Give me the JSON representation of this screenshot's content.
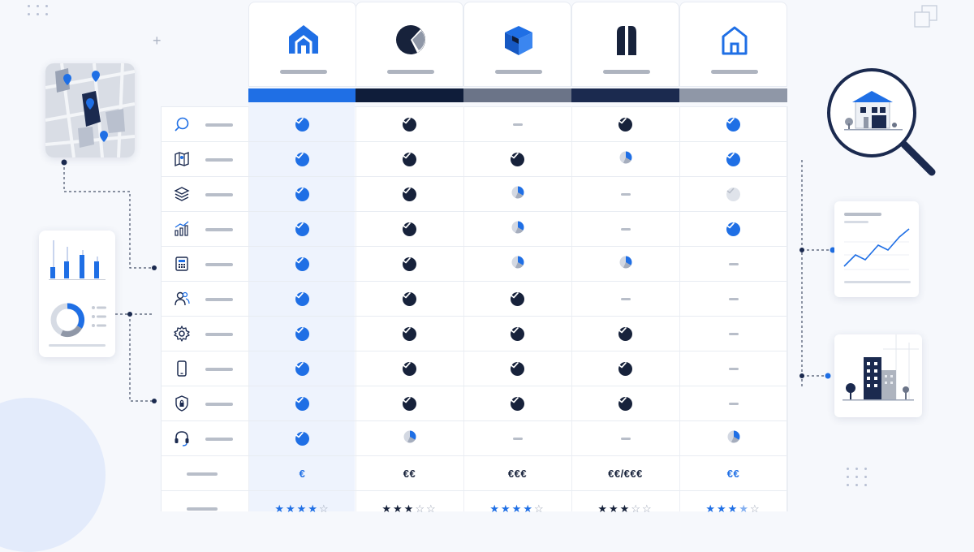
{
  "colors": {
    "accent_blue": "#1f6fe5",
    "navy": "#0f1d3a",
    "slate": "#6b7488",
    "dark_navy": "#1b2a4f",
    "grey_bar": "#8f97a7",
    "dash": "#b8bec9"
  },
  "vendors": [
    {
      "icon": "house-icon",
      "bar_color": "#1f6fe5",
      "check_color": "#1f6fe5"
    },
    {
      "icon": "pie-slice-icon",
      "bar_color": "#0f1d3a",
      "check_color": "#17223b"
    },
    {
      "icon": "cube-icon",
      "bar_color": "#6b7488",
      "check_color": "#17223b"
    },
    {
      "icon": "tower-icon",
      "bar_color": "#1b2a4f",
      "check_color": "#17223b"
    },
    {
      "icon": "house-outline-icon",
      "bar_color": "#8f97a7",
      "check_color": "#1f6fe5"
    }
  ],
  "feature_rows": [
    {
      "icon": "search-icon",
      "cells": [
        "check",
        "check",
        "dash",
        "check",
        "check"
      ]
    },
    {
      "icon": "map-icon",
      "cells": [
        "check",
        "check",
        "check",
        "partial",
        "check"
      ]
    },
    {
      "icon": "layers-icon",
      "cells": [
        "check",
        "check",
        "partial",
        "dash",
        "check-grey"
      ]
    },
    {
      "icon": "bar-chart-icon",
      "cells": [
        "check",
        "check",
        "partial",
        "dash",
        "check"
      ]
    },
    {
      "icon": "calculator-icon",
      "cells": [
        "check",
        "check",
        "partial",
        "partial",
        "dash"
      ]
    },
    {
      "icon": "users-icon",
      "cells": [
        "check",
        "check",
        "check",
        "dash",
        "dash"
      ]
    },
    {
      "icon": "gear-icon",
      "cells": [
        "check",
        "check",
        "check",
        "check",
        "dash"
      ]
    },
    {
      "icon": "smartphone-icon",
      "cells": [
        "check",
        "check",
        "check",
        "check",
        "dash"
      ]
    },
    {
      "icon": "shield-lock-icon",
      "cells": [
        "check",
        "check",
        "check",
        "check",
        "dash"
      ]
    },
    {
      "icon": "headset-icon",
      "cells": [
        "check",
        "partial",
        "dash",
        "dash",
        "partial"
      ]
    }
  ],
  "pricing": [
    "€",
    "€€",
    "€€€",
    "€€/€€€",
    "€€"
  ],
  "ratings": [
    {
      "text": "★★★★☆",
      "stars": 4
    },
    {
      "text": "★★★☆☆",
      "stars": 3
    },
    {
      "text": "★★★★☆",
      "stars": 4
    },
    {
      "text": "★★★☆☆",
      "stars": 3
    },
    {
      "text": "★★★★☆",
      "stars": 3.5
    }
  ],
  "rating_colors": [
    "#1f6fe5",
    "#17223b",
    "#1f6fe5",
    "#17223b",
    "#1f6fe5"
  ],
  "price_colors": [
    "#1f6fe5",
    "#17223b",
    "#17223b",
    "#17223b",
    "#1f6fe5"
  ],
  "side_icons": {
    "map_card": "map-pins-icon",
    "dashboard_card": "dashboard-icon",
    "magnifier": "house-magnifier-icon",
    "line_chart_card": "line-chart-icon",
    "building_card": "building-icon",
    "window_corner": "windows-icon"
  }
}
